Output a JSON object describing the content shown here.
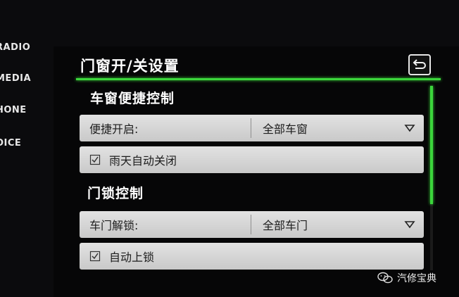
{
  "sidebar": {
    "items": [
      {
        "label": "RADIO"
      },
      {
        "label": "MEDIA"
      },
      {
        "label": "HONE"
      },
      {
        "label": "OICE"
      }
    ]
  },
  "header": {
    "title": "门窗开/关设置",
    "back_icon": "return-arrow-icon"
  },
  "sections": {
    "window": {
      "title": "车窗便捷控制",
      "convenience": {
        "label": "便捷开启:",
        "value": "全部车窗"
      },
      "rain_close": {
        "label": "雨天自动关闭",
        "checked": true
      }
    },
    "lock": {
      "title": "门锁控制",
      "unlock": {
        "label": "车门解锁:",
        "value": "全部车门"
      },
      "auto_lock": {
        "label": "自动上锁",
        "checked": true
      }
    }
  },
  "watermark": {
    "text": "汽修宝典"
  },
  "colors": {
    "accent": "#3bd63b",
    "row_bg": "#d8d8d8",
    "background": "#0b0b0d"
  }
}
